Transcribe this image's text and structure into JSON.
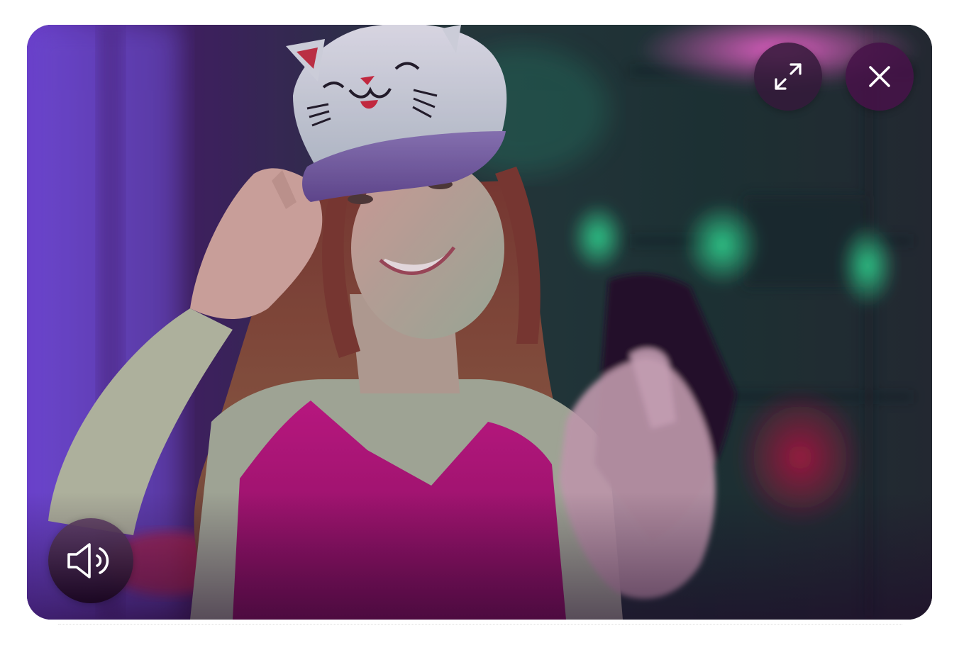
{
  "player": {
    "media": {
      "subject": "video frame",
      "palette": {
        "neon_purple": "#7a3cff",
        "neon_green": "#1fe08a",
        "magenta_top": "#c4147e",
        "cap_white": "#e8eef0"
      }
    },
    "controls": {
      "expand_icon": "expand-icon",
      "close_icon": "close-icon",
      "sound_icon": "speaker-sound-icon"
    },
    "colors": {
      "button_bg": "#2c1231",
      "icon_color": "#ffffff",
      "page_bg": "#ffffff"
    }
  }
}
